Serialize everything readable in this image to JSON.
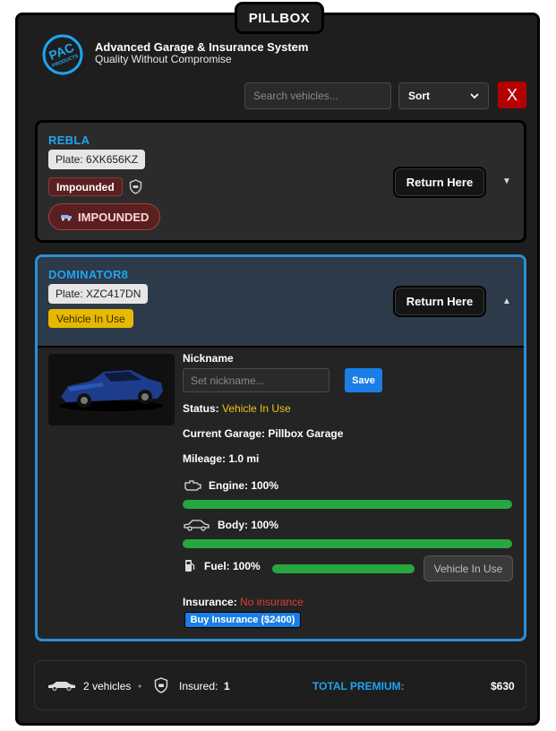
{
  "header": {
    "tab_title": "PILLBOX",
    "logo_text_top": "PAC",
    "logo_text_bottom": "PRODUCTS",
    "app_title": "Advanced Garage & Insurance System",
    "app_subtitle": "Quality Without Compromise"
  },
  "toolbar": {
    "search_placeholder": "Search vehicles...",
    "sort_label": "Sort",
    "close_label": "X"
  },
  "vehicles": [
    {
      "name": "REBLA",
      "plate": "Plate: 6XK656KZ",
      "status_badge": "Impounded",
      "impound_pill": "IMPOUNDED",
      "return_label": "Return Here",
      "chevron": "▼"
    },
    {
      "name": "DOMINATOR8",
      "plate": "Plate: XZC417DN",
      "status_badge": "Vehicle In Use",
      "return_label": "Return Here",
      "chevron": "▲",
      "details": {
        "nickname_label": "Nickname",
        "nickname_placeholder": "Set nickname...",
        "save_label": "Save",
        "status_label": "Status:",
        "status_value": "Vehicle In Use",
        "garage_text": "Current Garage: Pillbox Garage",
        "mileage_text": "Mileage: 1.0 mi",
        "engine_text": "Engine: 100%",
        "engine_pct": 100,
        "body_text": "Body: 100%",
        "body_pct": 100,
        "fuel_text": "Fuel: 100%",
        "fuel_pct": 100,
        "vehicle_in_use_button": "Vehicle In Use",
        "insurance_label": "Insurance:",
        "insurance_value": "No insurance",
        "buy_insurance_label": "Buy Insurance ($2400)"
      }
    }
  ],
  "footer": {
    "vehicle_count": "2 vehicles",
    "separator": "•",
    "insured_label": "Insured:",
    "insured_count": "1",
    "total_premium_label": "TOTAL PREMIUM:",
    "total_premium_value": "$630"
  },
  "colors": {
    "accent_blue": "#1ea4f2",
    "status_yellow": "#e6b800",
    "danger_red": "#b30000",
    "bar_green": "#27a640"
  }
}
